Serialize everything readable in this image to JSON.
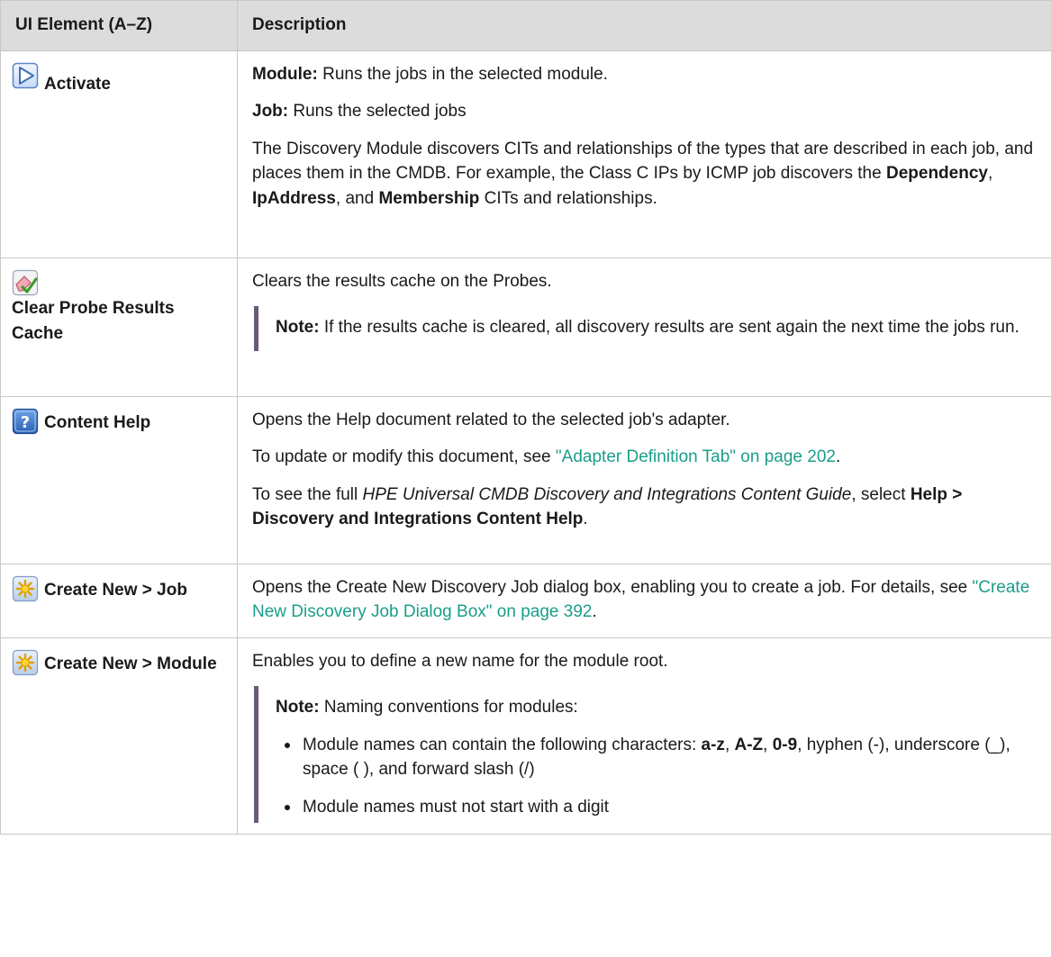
{
  "header": {
    "col1": "UI Element (A–Z)",
    "col2": "Description"
  },
  "rows": {
    "activate": {
      "label": "Activate",
      "icon": "play-icon",
      "p1_bold": "Module:",
      "p1_text": " Runs the jobs in the selected module.",
      "p2_bold": "Job:",
      "p2_text": " Runs the selected jobs",
      "p3_a": "The Discovery Module discovers CITs and relationships of the types that are described in each job, and places them in the CMDB. For example, the Class C IPs by ICMP job discovers the ",
      "p3_b1": "Dependency",
      "p3_c": ", ",
      "p3_b2": "IpAddress",
      "p3_d": ", and ",
      "p3_b3": "Membership",
      "p3_e": " CITs and relationships."
    },
    "clear_cache": {
      "label": "Clear Probe Results Cache",
      "icon": "eraser-check-icon",
      "p1": "Clears the results cache on the Probes.",
      "note_bold": "Note:",
      "note_text": "  If the results cache is cleared, all discovery results are sent again the next time the jobs run."
    },
    "content_help": {
      "label": "Content Help",
      "icon": "help-question-icon",
      "p1": "Opens the Help document related to the selected job's adapter.",
      "p2_a": "To update or modify this document, see ",
      "p2_link": "\"Adapter Definition Tab\" on page 202",
      "p2_b": ".",
      "p3_a": "To see the full ",
      "p3_i": "HPE Universal CMDB Discovery and Integrations Content Guide",
      "p3_b": ", select ",
      "p3_bold": "Help > Discovery and Integrations Content Help",
      "p3_c": "."
    },
    "create_job": {
      "label": "Create New > Job",
      "icon": "new-star-icon",
      "p1_a": "Opens the Create New Discovery Job dialog box, enabling you to create a job. For details, see ",
      "p1_link": "\"Create New Discovery Job Dialog Box\" on page 392",
      "p1_b": "."
    },
    "create_module": {
      "label": "Create New > Module",
      "icon": "new-star-icon",
      "p1": "Enables you to define a new name for the module root.",
      "note_bold": "Note:",
      "note_text": "  Naming conventions for modules:",
      "li1_a": "Module names can contain the following characters: ",
      "li1_b1": "a-z",
      "li1_c": ", ",
      "li1_b2": "A-Z",
      "li1_d": ", ",
      "li1_b3": "0-9",
      "li1_e": ", hyphen (-), underscore (_), space ( ), and forward slash (/)",
      "li2": "Module names must not start with a digit"
    }
  },
  "colors": {
    "header_bg": "#dcdcdc",
    "border": "#c8c8c8",
    "link": "#1a9e8a",
    "note_bar": "#6b5b78"
  }
}
